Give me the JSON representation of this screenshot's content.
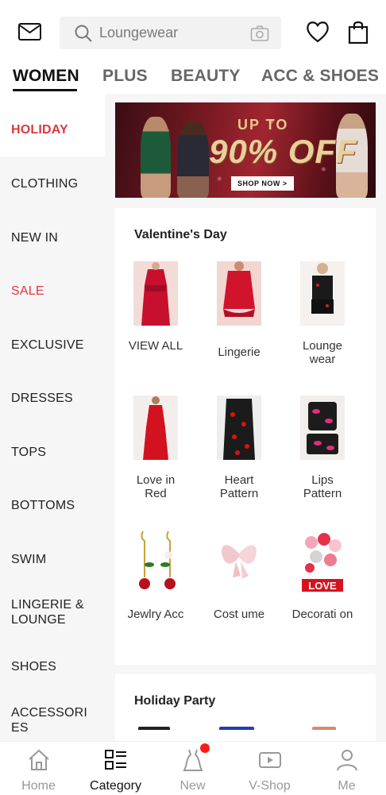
{
  "search": {
    "placeholder": "Loungewear"
  },
  "tabs": [
    {
      "label": "WOMEN",
      "active": true
    },
    {
      "label": "PLUS"
    },
    {
      "label": "BEAUTY"
    },
    {
      "label": "ACC & SHOES"
    }
  ],
  "sidebar": {
    "items": [
      {
        "label": "HOLIDAY",
        "active": true
      },
      {
        "label": "CLOTHING"
      },
      {
        "label": "NEW IN"
      },
      {
        "label": "SALE",
        "highlight": true
      },
      {
        "label": "EXCLUSIVE"
      },
      {
        "label": "DRESSES"
      },
      {
        "label": "TOPS"
      },
      {
        "label": "BOTTOMS"
      },
      {
        "label": "SWIM"
      },
      {
        "label": "LINGERIE & LOUNGE"
      },
      {
        "label": "SHOES"
      },
      {
        "label": "ACCESSORIES"
      }
    ]
  },
  "banner": {
    "line1": "UP TO",
    "line2": "90% OFF",
    "cta": "SHOP NOW >"
  },
  "valentines": {
    "title": "Valentine's Day",
    "items": [
      {
        "label": "VIEW ALL",
        "icon": "red-dress-thumbnail"
      },
      {
        "label": "Lingerie",
        "icon": "lingerie-thumbnail"
      },
      {
        "label": "Lounge wear",
        "icon": "loungewear-thumbnail"
      },
      {
        "label": "Love in Red",
        "icon": "red-dress-thumbnail"
      },
      {
        "label": "Heart Pattern",
        "icon": "heart-pattern-thumbnail"
      },
      {
        "label": "Lips Pattern",
        "icon": "lips-pattern-thumbnail"
      },
      {
        "label": "Jewlry Acc",
        "icon": "rose-earrings-thumbnail"
      },
      {
        "label": "Cost ume",
        "icon": "wings-costume-thumbnail"
      },
      {
        "label": "Decorati on",
        "icon": "heart-balloons-thumbnail"
      }
    ]
  },
  "holiday_party": {
    "title": "Holiday Party"
  },
  "bottom_nav": {
    "items": [
      {
        "label": "Home",
        "icon": "home-icon"
      },
      {
        "label": "Category",
        "icon": "category-icon",
        "active": true
      },
      {
        "label": "New",
        "icon": "new-dress-icon"
      },
      {
        "label": "V-Shop",
        "icon": "video-shop-icon"
      },
      {
        "label": "Me",
        "icon": "person-icon"
      }
    ]
  },
  "colors": {
    "accent_red": "#e0383e",
    "text_dark": "#111111",
    "badge_red": "#ff1a1a"
  }
}
